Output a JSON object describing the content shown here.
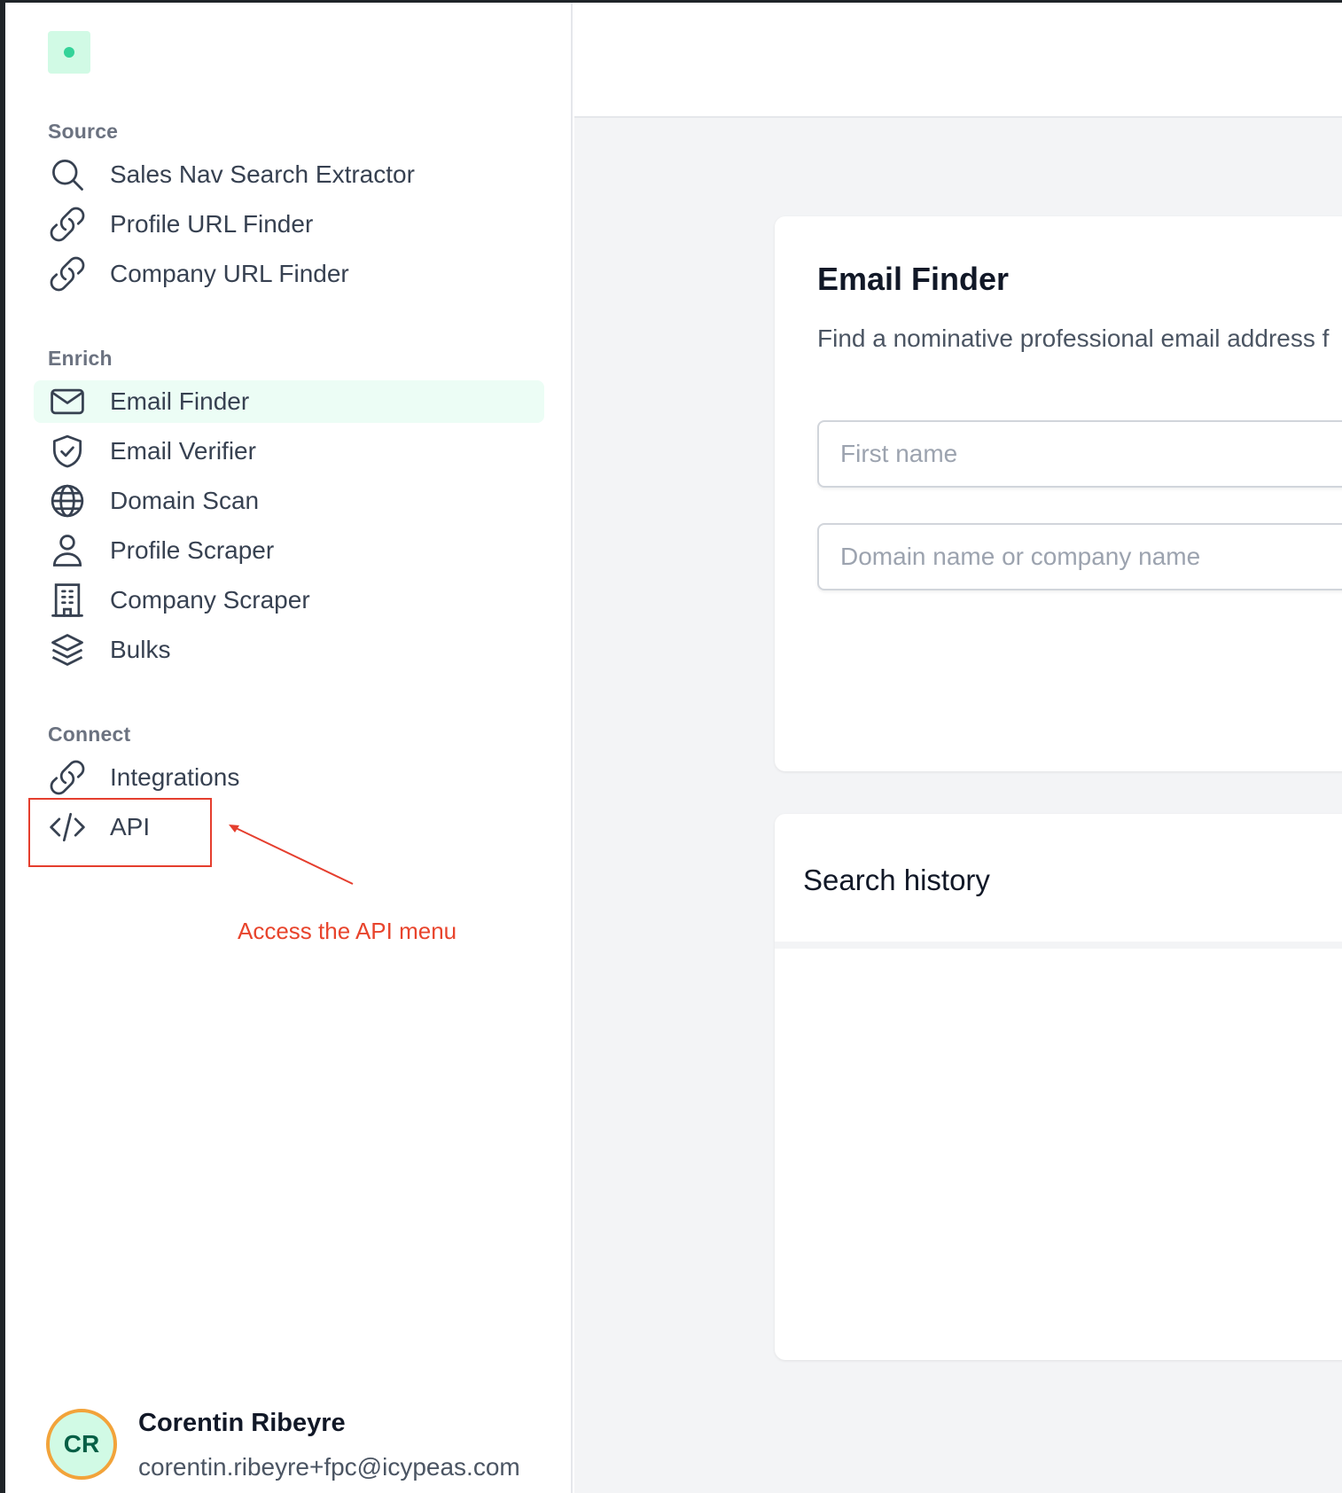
{
  "sidebar": {
    "sections": {
      "source": "Source",
      "enrich": "Enrich",
      "connect": "Connect"
    },
    "items": {
      "sales_nav": "Sales Nav Search Extractor",
      "profile_url": "Profile URL Finder",
      "company_url": "Company URL Finder",
      "email_finder": "Email Finder",
      "email_verifier": "Email Verifier",
      "domain_scan": "Domain Scan",
      "profile_scraper": "Profile Scraper",
      "company_scraper": "Company Scraper",
      "bulks": "Bulks",
      "integrations": "Integrations",
      "api": "API"
    },
    "icons": {
      "sales_nav": "search-icon",
      "profile_url": "link-icon",
      "company_url": "link-icon",
      "email_finder": "envelope-icon",
      "email_verifier": "shield-check-icon",
      "domain_scan": "globe-icon",
      "profile_scraper": "user-icon",
      "company_scraper": "building-icon",
      "bulks": "layers-icon",
      "integrations": "link-icon",
      "api": "code-icon"
    },
    "active_item": "email_finder"
  },
  "annotation": {
    "text": "Access the API menu",
    "color": "#e8442c"
  },
  "user": {
    "initials": "CR",
    "name": "Corentin Ribeyre",
    "email": "corentin.ribeyre+fpc@icypeas.com"
  },
  "email_finder": {
    "title": "Email Finder",
    "description": "Find a nominative professional email address f",
    "first_name_placeholder": "First name",
    "domain_placeholder": "Domain name or company name"
  },
  "search_history": {
    "title": "Search history"
  },
  "colors": {
    "accent": "#34d399",
    "active_bg": "#ecfdf5",
    "avatar_ring": "#f2a33a"
  }
}
